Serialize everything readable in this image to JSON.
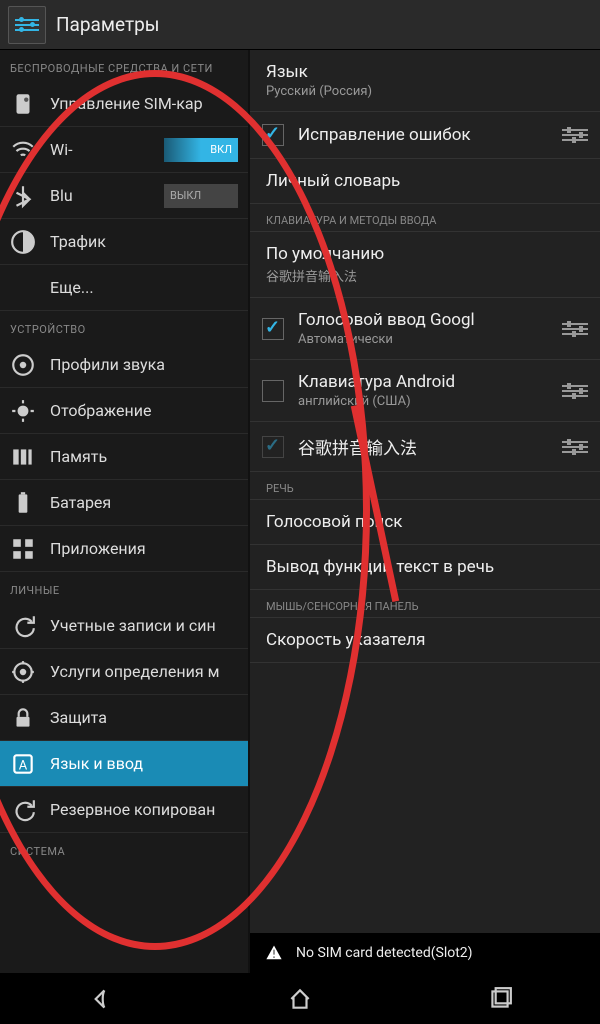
{
  "header": {
    "title": "Параметры"
  },
  "sidebar": {
    "sections": [
      {
        "header": "БЕСПРОВОДНЫЕ СРЕДСТВА И СЕТИ",
        "items": [
          {
            "label": "Управление SIM-кар",
            "icon": "sim"
          },
          {
            "label": "Wi-",
            "icon": "wifi",
            "toggle": "ВКЛ",
            "on": true
          },
          {
            "label": "Blu",
            "icon": "bluetooth",
            "toggle": "ВЫКЛ",
            "on": false
          },
          {
            "label": "Трафик",
            "icon": "data"
          },
          {
            "label": "Еще...",
            "icon": ""
          }
        ]
      },
      {
        "header": "УСТРОЙСТВО",
        "items": [
          {
            "label": "Профили звука",
            "icon": "sound"
          },
          {
            "label": "Отображение",
            "icon": "display"
          },
          {
            "label": "Память",
            "icon": "storage"
          },
          {
            "label": "Батарея",
            "icon": "battery"
          },
          {
            "label": "Приложения",
            "icon": "apps"
          }
        ]
      },
      {
        "header": "ЛИЧНЫЕ",
        "items": [
          {
            "label": "Учетные записи и син",
            "icon": "sync"
          },
          {
            "label": "Услуги определения м",
            "icon": "location"
          },
          {
            "label": "Защита",
            "icon": "lock"
          },
          {
            "label": "Язык и ввод",
            "icon": "lang",
            "selected": true
          },
          {
            "label": "Резервное копирован",
            "icon": "backup"
          }
        ]
      },
      {
        "header": "СИСТЕМА",
        "items": []
      }
    ]
  },
  "content": {
    "language": {
      "title": "Язык",
      "sub": "Русский (Россия)"
    },
    "spellcheck": {
      "label": "Исправление ошибок",
      "checked": true
    },
    "dictionary": {
      "label": "Личный словарь"
    },
    "kb_header": "КЛАВИАТУРА И МЕТОДЫ ВВОДА",
    "default_kb": {
      "title": "По умолчанию",
      "sub": "谷歌拼音输入法"
    },
    "keyboards": [
      {
        "label": "Голосовой ввод Googl",
        "sub": "Автоматически",
        "checked": true
      },
      {
        "label": "Клавиатура Android",
        "sub": "английский (США)",
        "checked": false
      },
      {
        "label": "谷歌拼音输入法",
        "sub": "",
        "checked": true,
        "dim": true
      }
    ],
    "speech_header": "РЕЧЬ",
    "voice_search": "Голосовой поиск",
    "tts": "Вывод функции текст в речь",
    "mouse_header": "МЫШЬ/СЕНСОРНАЯ ПАНЕЛЬ",
    "pointer": "Скорость указателя"
  },
  "statusbar": {
    "text": "No SIM card detected(Slot2)"
  }
}
